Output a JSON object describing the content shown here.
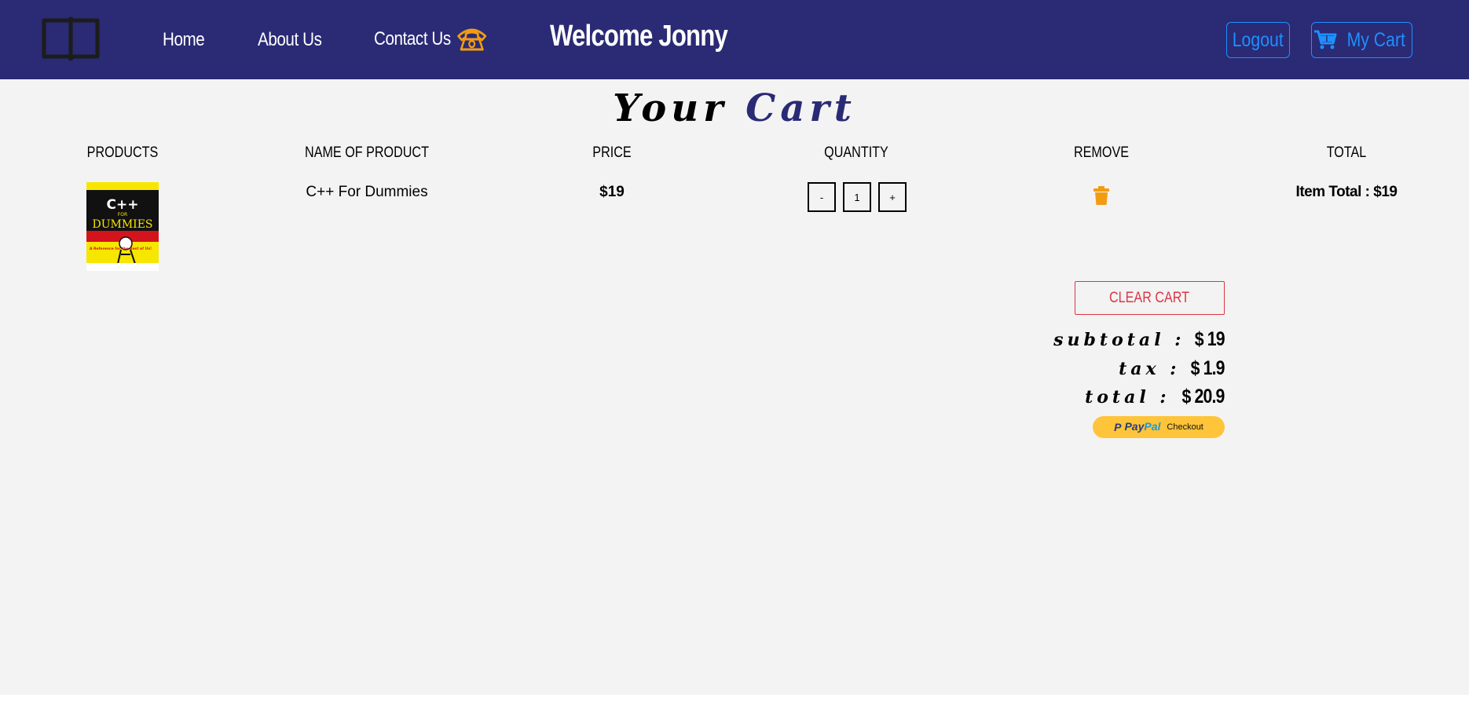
{
  "navbar": {
    "home": "Home",
    "about": "About Us",
    "contact": "Contact Us",
    "welcome": "Welcome Jonny",
    "logout": "Logout",
    "my_cart": "My Cart",
    "icons": [
      "book-logo-icon",
      "phone-icon",
      "cart-icon"
    ],
    "colors": {
      "background": "#2a2a75",
      "accent": "#1e90ff",
      "phone": "#f39c12"
    }
  },
  "title": {
    "part1": "Your",
    "part2": "Cart"
  },
  "table": {
    "headers": [
      "PRODUCTS",
      "NAME OF PRODUCT",
      "PRICE",
      "QUANTITY",
      "REMOVE",
      "TOTAL"
    ],
    "rows": [
      {
        "image_label": "C++ For Dummies cover",
        "name": "C++ For Dummies",
        "price": "$19",
        "quantity": "1",
        "decrement": "-",
        "increment": "+",
        "item_total": "Item Total : $19"
      }
    ]
  },
  "summary": {
    "clear_cart": "CLEAR CART",
    "subtotal_label": "subtotal :",
    "subtotal_value": "$ 19",
    "tax_label": "tax :",
    "tax_value": "$ 1.9",
    "total_label": "total :",
    "total_value": "$ 20.9"
  },
  "paypal": {
    "p": "P",
    "pay": "Pay",
    "pal": "Pal",
    "checkout": "Checkout"
  },
  "cover": {
    "line1": "C++",
    "line2": "FOR",
    "line3": "DUMMIES",
    "line4": "A Reference for the Rest of Us!"
  }
}
